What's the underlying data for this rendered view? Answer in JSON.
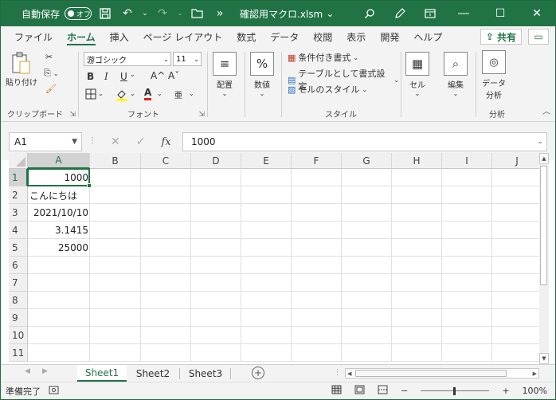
{
  "titlebar": {
    "autosave_label": "自動保存",
    "autosave_state": "オフ",
    "filename": "確認用マクロ.xlsm",
    "filename_caret": "⌄",
    "more": "»"
  },
  "tabs": [
    "ファイル",
    "ホーム",
    "挿入",
    "ページ レイアウト",
    "数式",
    "データ",
    "校閲",
    "表示",
    "開発",
    "ヘルプ"
  ],
  "active_tab": "ホーム",
  "share_label": "共有",
  "ribbon": {
    "clipboard": {
      "paste_label": "貼り付け",
      "group_label": "クリップボード"
    },
    "font": {
      "font_name": "游ゴシック",
      "font_size": "11",
      "group_label": "フォント",
      "bold": "B",
      "italic": "I",
      "underline": "U",
      "grow": "A^",
      "shrink": "Aˇ",
      "font_color": "A"
    },
    "alignment": {
      "label": "配置"
    },
    "number": {
      "label": "数値",
      "symbol": "%"
    },
    "styles": {
      "conditional": "条件付き書式",
      "table": "テーブルとして書式設定",
      "cell_styles": "セルのスタイル",
      "group_label": "スタイル"
    },
    "cells": {
      "label": "セル"
    },
    "editing": {
      "label": "編集"
    },
    "analysis": {
      "button_label_1": "データ",
      "button_label_2": "分析",
      "group_label": "分析"
    }
  },
  "formula_bar": {
    "name_box": "A1",
    "fx": "fx",
    "content": "1000"
  },
  "grid": {
    "columns": [
      "A",
      "B",
      "C",
      "D",
      "E",
      "F",
      "G",
      "H",
      "I",
      "J"
    ],
    "rows": [
      "1",
      "2",
      "3",
      "4",
      "5",
      "6",
      "7",
      "8",
      "9",
      "10",
      "11"
    ],
    "cells": {
      "A1": "1000",
      "A2": "こんにちは",
      "A3": "2021/10/10",
      "A4": "3.1415",
      "A5": "25000"
    },
    "active_cell": "A1"
  },
  "sheets": [
    "Sheet1",
    "Sheet2",
    "Sheet3"
  ],
  "active_sheet": "Sheet1",
  "status": {
    "ready": "準備完了",
    "zoom": "100%"
  },
  "colors": {
    "accent": "#217346",
    "header_bg": "#f0f0f0"
  }
}
